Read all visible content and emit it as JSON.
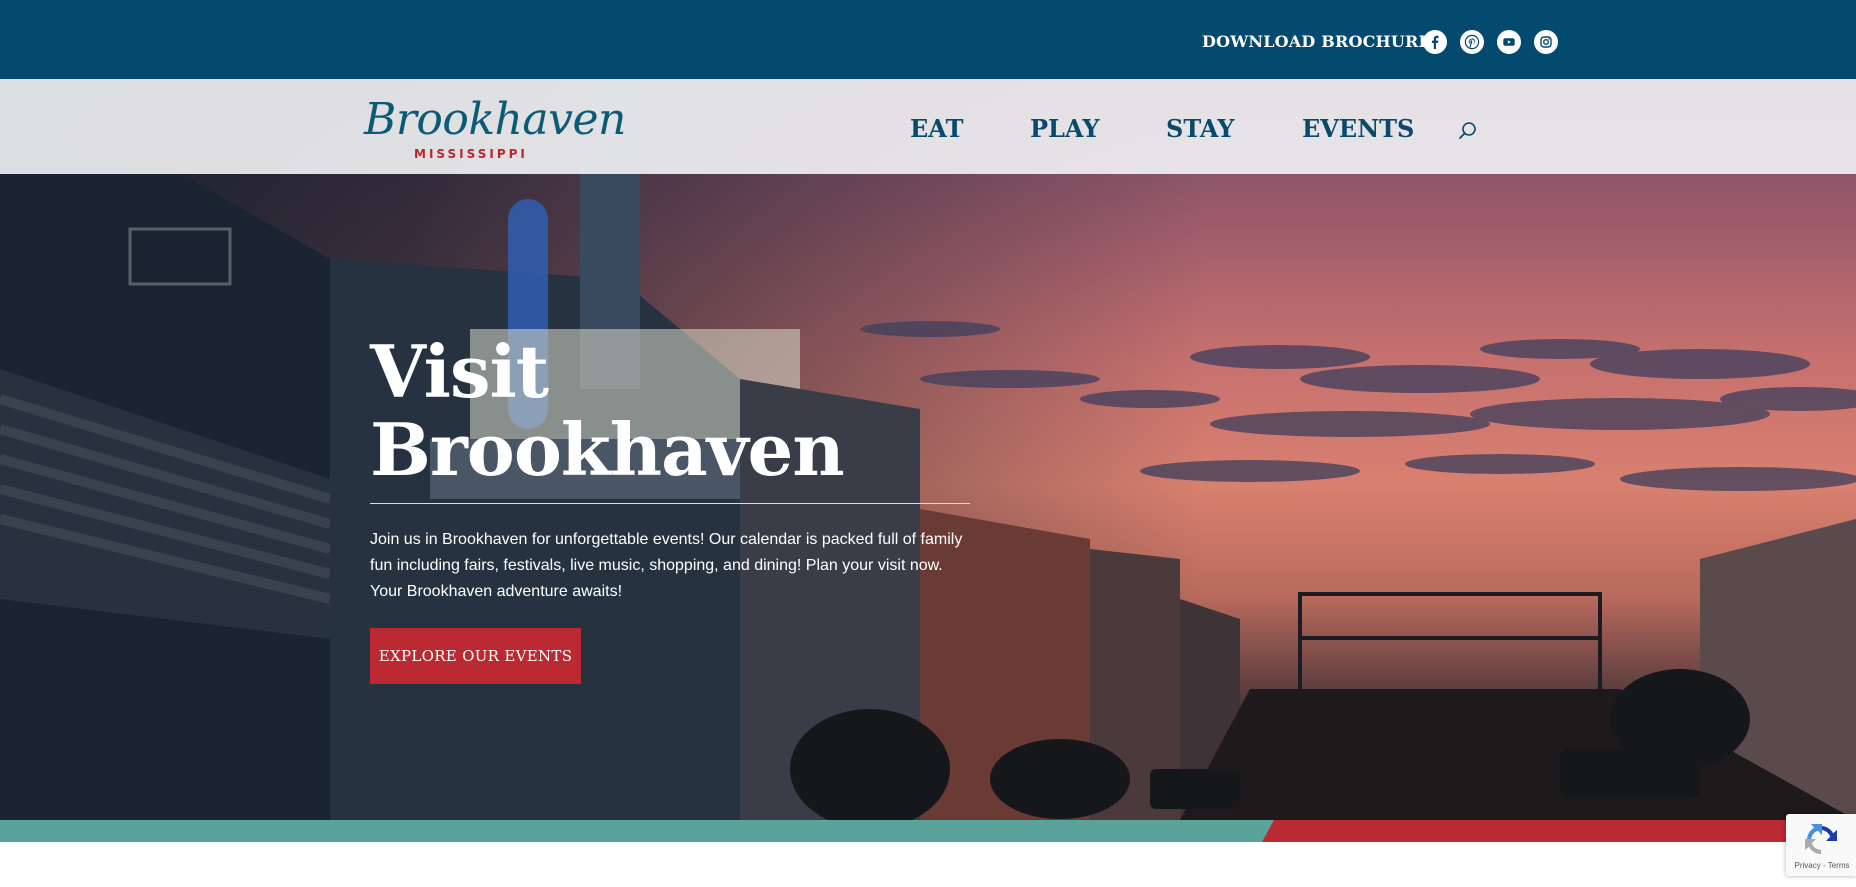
{
  "topbar": {
    "brochure_label": "DOWNLOAD BROCHURE",
    "social": [
      "facebook-icon",
      "pinterest-icon",
      "youtube-icon",
      "instagram-icon"
    ]
  },
  "logo": {
    "name": "Brookhaven",
    "sub": "MISSISSIPPI"
  },
  "nav": {
    "items": [
      {
        "label": "EAT"
      },
      {
        "label": "PLAY"
      },
      {
        "label": "STAY"
      },
      {
        "label": "EVENTS"
      }
    ],
    "search_icon": "search-icon"
  },
  "hero": {
    "title_line1": "Visit",
    "title_line2": "Brookhaven",
    "description": "Join us in Brookhaven for unforgettable events! Our calendar is packed full of family fun including fairs, festivals, live music, shopping, and dining! Plan your visit now. Your Brookhaven adventure awaits!",
    "cta_label": "EXPLORE OUR EVENTS"
  },
  "recaptcha": {
    "footer": "Privacy - Terms"
  },
  "colors": {
    "topbar": "#04496e",
    "nav_text": "#074a6c",
    "accent_red": "#bb2a32",
    "accent_teal": "#5aa39b"
  }
}
